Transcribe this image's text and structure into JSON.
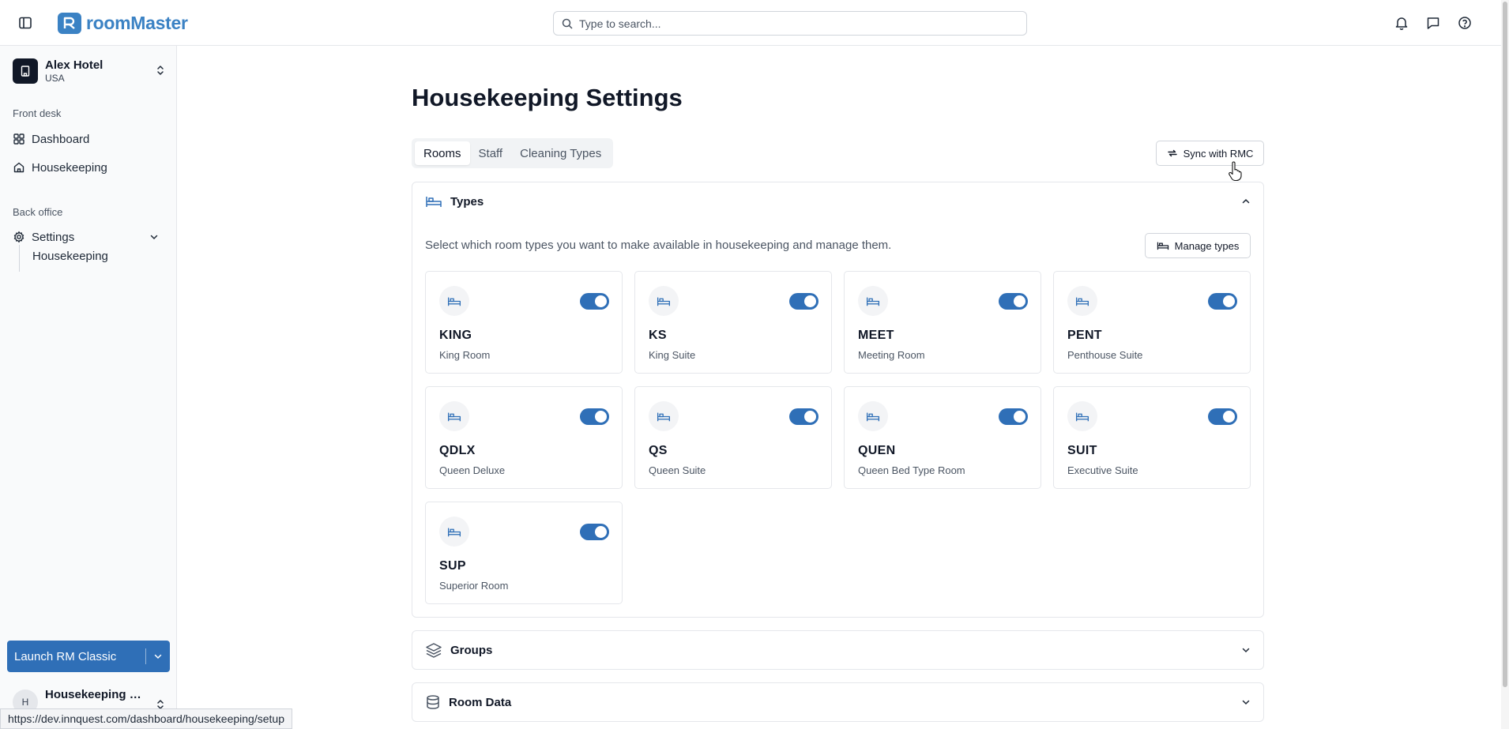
{
  "app": {
    "brand": "roomMaster",
    "brand_color": "#3b82c4",
    "accent": "#2f6fb7"
  },
  "search": {
    "placeholder": "Type to search..."
  },
  "top_icons": [
    "bell-icon",
    "message-icon",
    "help-icon"
  ],
  "sidebar": {
    "hotel": {
      "name": "Alex Hotel",
      "country": "USA"
    },
    "sections": [
      {
        "label": "Front desk",
        "items": [
          {
            "label": "Dashboard",
            "icon": "dashboard-icon"
          },
          {
            "label": "Housekeeping",
            "icon": "home-icon"
          }
        ]
      },
      {
        "label": "Back office",
        "items": [
          {
            "label": "Settings",
            "icon": "gear-icon",
            "expanded": true,
            "children": [
              {
                "label": "Housekeeping"
              }
            ]
          }
        ]
      }
    ],
    "launch": {
      "label": "Launch RM Classic"
    },
    "user": {
      "initial": "H",
      "name": "Housekeeping M..."
    }
  },
  "status_url": "https://dev.innquest.com/dashboard/housekeeping/setup",
  "main": {
    "title": "Housekeeping Settings",
    "tabs": [
      {
        "label": "Rooms",
        "active": true
      },
      {
        "label": "Staff"
      },
      {
        "label": "Cleaning Types"
      }
    ],
    "sync_label": "Sync with RMC",
    "types_panel": {
      "title": "Types",
      "description": "Select which room types you want to make available in housekeeping and manage them.",
      "manage_label": "Manage types",
      "room_types": [
        {
          "code": "KING",
          "name": "King Room",
          "enabled": true
        },
        {
          "code": "KS",
          "name": "King Suite",
          "enabled": true
        },
        {
          "code": "MEET",
          "name": "Meeting Room",
          "enabled": true
        },
        {
          "code": "PENT",
          "name": "Penthouse Suite",
          "enabled": true
        },
        {
          "code": "QDLX",
          "name": "Queen Deluxe",
          "enabled": true
        },
        {
          "code": "QS",
          "name": "Queen Suite",
          "enabled": true
        },
        {
          "code": "QUEN",
          "name": "Queen Bed Type Room",
          "enabled": true
        },
        {
          "code": "SUIT",
          "name": "Executive Suite",
          "enabled": true
        },
        {
          "code": "SUP",
          "name": "Superior Room",
          "enabled": true
        }
      ]
    },
    "groups_panel": {
      "title": "Groups"
    },
    "room_data_panel": {
      "title": "Room Data"
    }
  }
}
